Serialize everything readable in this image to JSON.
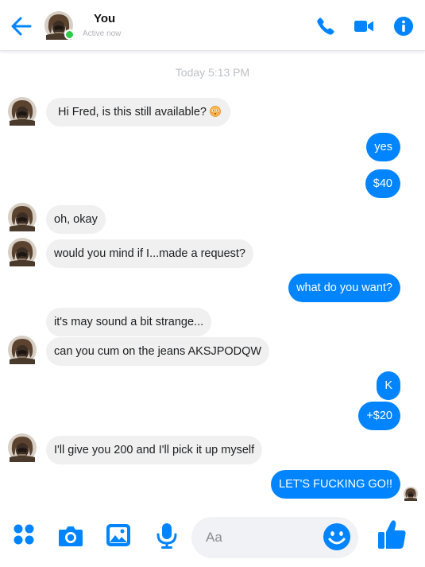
{
  "header": {
    "name": "You",
    "status": "Active now"
  },
  "conversation": {
    "timestamp": "Today 5:13 PM",
    "messages": [
      {
        "side": "received",
        "text": "Hi Fred, is this still available?",
        "emoji": "flushed-face"
      },
      {
        "side": "sent",
        "text": "yes"
      },
      {
        "side": "sent",
        "text": "$40"
      },
      {
        "side": "received",
        "text": "oh, okay"
      },
      {
        "side": "received",
        "text": "would you mind if I...made a request?"
      },
      {
        "side": "sent",
        "text": "what do you want?"
      },
      {
        "side": "received",
        "text": "it's may sound a bit strange..."
      },
      {
        "side": "received",
        "text": "can you cum on the jeans AKSJPODQW"
      },
      {
        "side": "sent",
        "text": "K"
      },
      {
        "side": "sent",
        "text": "+$20"
      },
      {
        "side": "received",
        "text": "I'll give you 200 and I'll pick it up myself"
      },
      {
        "side": "sent",
        "text": "LET'S FUCKING GO!!"
      }
    ]
  },
  "composer": {
    "placeholder": "Aa"
  },
  "colors": {
    "accent": "#0084ff",
    "received_bubble": "#f0f0f0",
    "online": "#31cc46"
  }
}
